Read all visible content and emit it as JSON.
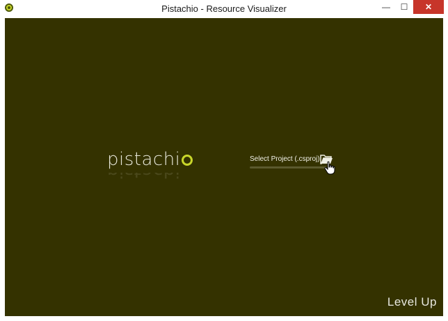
{
  "window": {
    "title": "Pistachio - Resource Visualizer",
    "controls": {
      "minimize_icon": "minimize-icon",
      "maximize_icon": "maximize-icon",
      "close_icon": "close-icon",
      "minimize_glyph": "—",
      "maximize_glyph": "☐",
      "close_glyph": "✕"
    }
  },
  "app": {
    "logo_text": "pistachi",
    "background_color": "#343200",
    "accent_color": "#c9d62a"
  },
  "project_select": {
    "label": "Select Project (.csproj)",
    "button_icon": "folder-open-icon"
  },
  "watermark": {
    "text": "Level Up"
  }
}
